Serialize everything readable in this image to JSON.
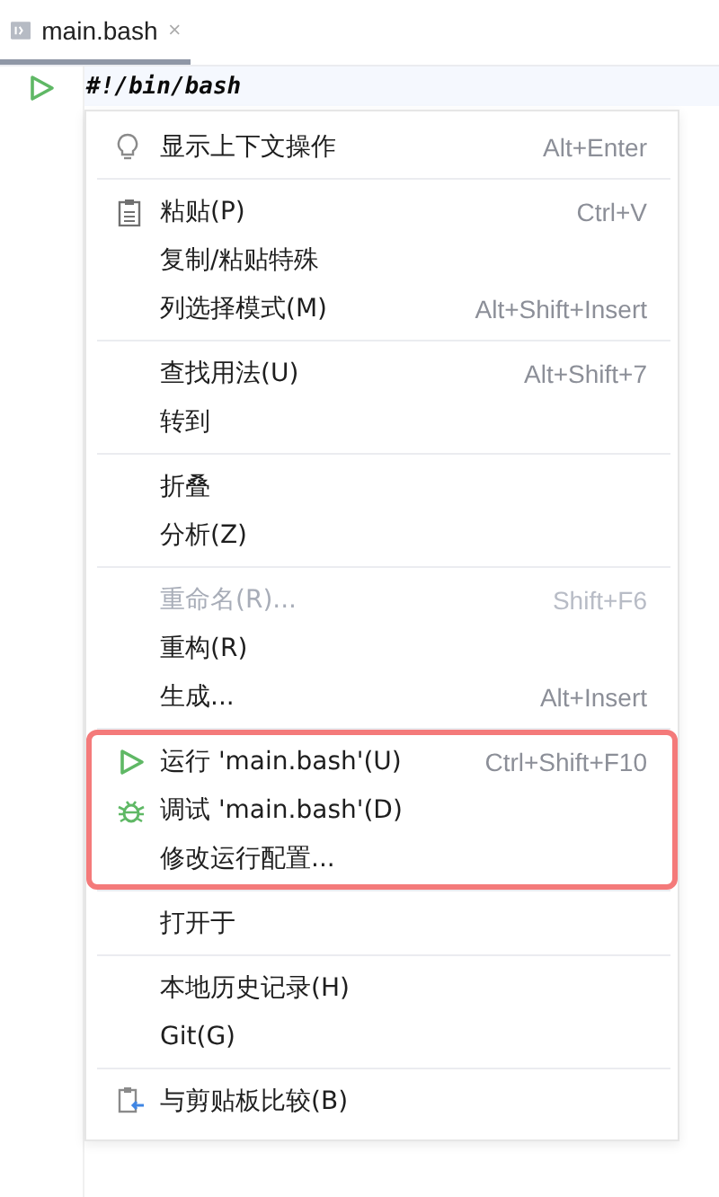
{
  "tab": {
    "title": "main.bash",
    "selected": true
  },
  "editor": {
    "code_line": "#!/bin/bash"
  },
  "menu": {
    "groups": [
      {
        "highlighted": false,
        "items": [
          {
            "kind": "bulb",
            "label": "显示上下文操作",
            "shortcut": "Alt+Enter",
            "disabled": false
          }
        ]
      },
      {
        "highlighted": false,
        "items": [
          {
            "kind": "clipboard",
            "label": "粘贴(P)",
            "shortcut": "Ctrl+V",
            "disabled": false
          },
          {
            "kind": "plain",
            "label": "复制/粘贴特殊",
            "disabled": false
          },
          {
            "kind": "plain",
            "label": "列选择模式(M)",
            "shortcut": "Alt+Shift+Insert",
            "disabled": false
          }
        ]
      },
      {
        "highlighted": false,
        "items": [
          {
            "kind": "plain",
            "label": "查找用法(U)",
            "shortcut": "Alt+Shift+7",
            "disabled": false
          },
          {
            "kind": "plain",
            "label": "转到",
            "disabled": false
          }
        ]
      },
      {
        "highlighted": false,
        "items": [
          {
            "kind": "plain",
            "label": "折叠",
            "disabled": false
          },
          {
            "kind": "plain",
            "label": "分析(Z)",
            "disabled": false
          }
        ]
      },
      {
        "highlighted": false,
        "items": [
          {
            "kind": "plain",
            "label": "重命名(R)...",
            "shortcut": "Shift+F6",
            "disabled": true
          },
          {
            "kind": "plain",
            "label": "重构(R)",
            "disabled": false
          },
          {
            "kind": "plain",
            "label": "生成...",
            "shortcut": "Alt+Insert",
            "disabled": false
          }
        ]
      },
      {
        "highlighted": true,
        "items": [
          {
            "kind": "run",
            "label": "运行 'main.bash'(U)",
            "shortcut": "Ctrl+Shift+F10",
            "disabled": false
          },
          {
            "kind": "debug",
            "label": "调试 'main.bash'(D)",
            "disabled": false
          },
          {
            "kind": "plain",
            "label": "修改运行配置...",
            "disabled": false
          }
        ]
      },
      {
        "highlighted": false,
        "items": [
          {
            "kind": "plain",
            "label": "打开于",
            "disabled": false
          }
        ]
      },
      {
        "highlighted": false,
        "items": [
          {
            "kind": "plain",
            "label": "本地历史记录(H)",
            "disabled": false
          },
          {
            "kind": "plain",
            "label": "Git(G)",
            "disabled": false
          }
        ]
      },
      {
        "highlighted": false,
        "items": [
          {
            "kind": "compare",
            "label": "与剪贴板比较(B)",
            "disabled": false
          }
        ]
      }
    ]
  }
}
